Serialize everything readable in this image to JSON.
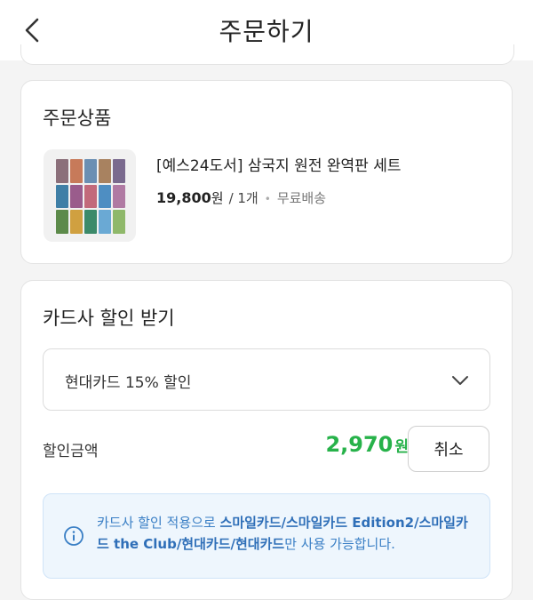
{
  "header": {
    "title": "주문하기"
  },
  "order_items": {
    "title": "주문상품",
    "item": {
      "name": "[예스24도서] 삼국지 원전 완역판 세트",
      "price": "19,800",
      "price_unit": "원",
      "quantity": "/ 1개",
      "shipping": "무료배송"
    }
  },
  "card_discount": {
    "title": "카드사 할인 받기",
    "selected_option": "현대카드 15% 할인",
    "amount_label": "할인금액",
    "amount": "2,970",
    "amount_unit": "원",
    "cancel_label": "취소",
    "notice": {
      "prefix": "카드사 할인 적용으로 ",
      "cards": "스마일카드/스마일카드 Edition2/스마일카드 the Club/현대카드/현대카드",
      "suffix": "만 사용 가능합니다."
    }
  },
  "colors": {
    "accent_green": "#27b24a",
    "notice_blue": "#3a7fc5",
    "notice_bg": "#eef6fd"
  },
  "icons": [
    "back-arrow-icon",
    "chevron-down-icon",
    "info-icon"
  ]
}
